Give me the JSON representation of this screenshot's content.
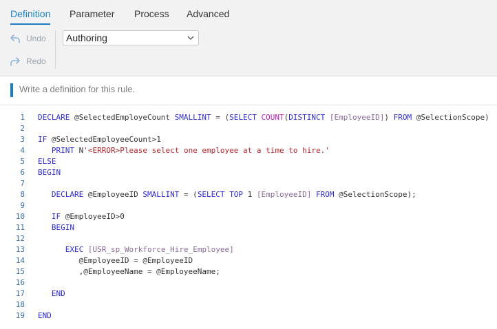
{
  "tabs": [
    "Definition",
    "Parameter",
    "Process",
    "Advanced"
  ],
  "toolbar": {
    "undo_label": "Undo",
    "redo_label": "Redo",
    "mode_select": {
      "selected": "Authoring"
    }
  },
  "description": {
    "placeholder": "Write a definition for this rule."
  },
  "code": {
    "lines": [
      {
        "n": "1",
        "tokens": [
          [
            "kw",
            "DECLARE"
          ],
          [
            "t",
            " @SelectedEmployeCount "
          ],
          [
            "kw",
            "SMALLINT"
          ],
          [
            "t",
            " = ("
          ],
          [
            "kw",
            "SELECT"
          ],
          [
            "t",
            " "
          ],
          [
            "fn",
            "COUNT"
          ],
          [
            "t",
            "("
          ],
          [
            "kw",
            "DISTINCT"
          ],
          [
            "t",
            " "
          ],
          [
            "br",
            "[EmployeeID]"
          ],
          [
            "t",
            ") "
          ],
          [
            "kw",
            "FROM"
          ],
          [
            "t",
            " @SelectionScope)"
          ]
        ]
      },
      {
        "n": "2",
        "tokens": []
      },
      {
        "n": "3",
        "tokens": [
          [
            "kw",
            "IF"
          ],
          [
            "t",
            " @SelectedEmployeeCount>1"
          ]
        ]
      },
      {
        "n": "4",
        "tokens": [
          [
            "t",
            "   "
          ],
          [
            "kw",
            "PRINT"
          ],
          [
            "t",
            " N"
          ],
          [
            "str",
            "'<ERROR>Please select one employee at a time to hire.'"
          ]
        ]
      },
      {
        "n": "5",
        "tokens": [
          [
            "kw",
            "ELSE"
          ]
        ]
      },
      {
        "n": "6",
        "tokens": [
          [
            "kw",
            "BEGIN"
          ]
        ]
      },
      {
        "n": "7",
        "tokens": []
      },
      {
        "n": "8",
        "tokens": [
          [
            "t",
            "   "
          ],
          [
            "kw",
            "DECLARE"
          ],
          [
            "t",
            " @EmployeeID "
          ],
          [
            "kw",
            "SMALLINT"
          ],
          [
            "t",
            " = ("
          ],
          [
            "kw",
            "SELECT"
          ],
          [
            "t",
            " "
          ],
          [
            "kw",
            "TOP"
          ],
          [
            "t",
            " 1 "
          ],
          [
            "br",
            "[EmployeeID]"
          ],
          [
            "t",
            " "
          ],
          [
            "kw",
            "FROM"
          ],
          [
            "t",
            " @SelectionScope);"
          ]
        ]
      },
      {
        "n": "9",
        "tokens": []
      },
      {
        "n": "10",
        "tokens": [
          [
            "t",
            "   "
          ],
          [
            "kw",
            "IF"
          ],
          [
            "t",
            " @EmployeeID>0"
          ]
        ]
      },
      {
        "n": "11",
        "tokens": [
          [
            "t",
            "   "
          ],
          [
            "kw",
            "BEGIN"
          ]
        ]
      },
      {
        "n": "12",
        "tokens": []
      },
      {
        "n": "13",
        "tokens": [
          [
            "t",
            "      "
          ],
          [
            "kw",
            "EXEC"
          ],
          [
            "t",
            " "
          ],
          [
            "br",
            "[USR_sp_Workforce_Hire_Employee]"
          ]
        ]
      },
      {
        "n": "14",
        "tokens": [
          [
            "t",
            "         @EmployeeID = @EmployeeID"
          ]
        ]
      },
      {
        "n": "15",
        "tokens": [
          [
            "t",
            "         ,@EmployeeName = @EmployeeName;"
          ]
        ]
      },
      {
        "n": "16",
        "tokens": []
      },
      {
        "n": "17",
        "tokens": [
          [
            "t",
            "   "
          ],
          [
            "kw",
            "END"
          ]
        ]
      },
      {
        "n": "18",
        "tokens": []
      },
      {
        "n": "19",
        "tokens": [
          [
            "kw",
            "END"
          ]
        ]
      }
    ]
  }
}
